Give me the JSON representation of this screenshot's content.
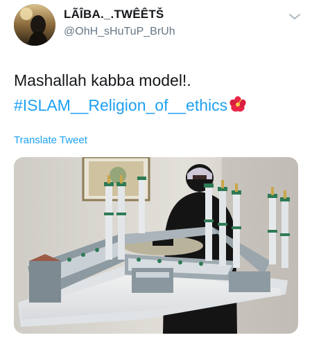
{
  "user": {
    "display_name": "LÃÎBA._.TWÊÊTŠ",
    "handle": "@OhH_sHuTuP_BrUh"
  },
  "tweet": {
    "text_line1": "Mashallah kabba model!.",
    "hashtag": "#ISLAM__Religion_of__ethics",
    "flower_emoji": "hibiscus-icon",
    "translate_label": "Translate Tweet"
  },
  "icons": {
    "menu": "chevron-down-icon"
  },
  "colors": {
    "link": "#1da1f2",
    "text": "#14171a",
    "secondary": "#657786"
  }
}
